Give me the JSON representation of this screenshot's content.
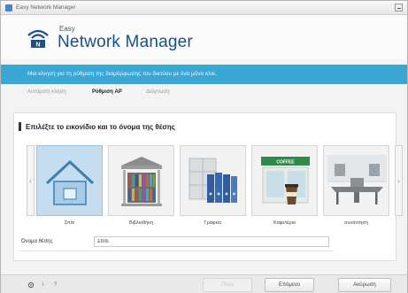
{
  "window": {
    "title": "Easy Network Manager"
  },
  "header": {
    "brand_small": "Easy",
    "brand": "Network Manager"
  },
  "banner": {
    "text": "Μια κίνηση για τη ρύθμιση της διαμόρφωσης του δικτύου με ένα μόνο κλικ."
  },
  "tabs": [
    {
      "label": "Αυτόματη κλήση"
    },
    {
      "label": "Ρύθμιση AP"
    },
    {
      "label": "Διάγνωση"
    }
  ],
  "section": {
    "title": "Επιλέξτε το εικονίδιο και το όνομα της θέσης"
  },
  "locations": [
    {
      "label": "Σπίτι",
      "icon": "house-icon",
      "selected": true
    },
    {
      "label": "Βιβλιοθήκη",
      "icon": "library-icon",
      "selected": false
    },
    {
      "label": "Γραφείο",
      "icon": "office-binders-icon",
      "selected": false
    },
    {
      "label": "Καφετέρια",
      "icon": "coffee-shop-icon",
      "selected": false,
      "sign_text": "COFFEE"
    },
    {
      "label": "συνάντηση",
      "icon": "meeting-room-icon",
      "selected": false
    }
  ],
  "name_field": {
    "label": "Όνομα θέσης",
    "value": "Σπίτι"
  },
  "footer": {
    "back_label": "Πίσω",
    "next_label": "Επόμενο",
    "cancel_label": "Ακύρωση",
    "icons": [
      "settings-icon",
      "info-icon",
      "help-icon"
    ],
    "info_glyph": "i",
    "help_glyph": "?"
  },
  "colors": {
    "banner": "#3aa6d4",
    "brand": "#1a4f88",
    "selected_tile": "#c6ddf0"
  }
}
